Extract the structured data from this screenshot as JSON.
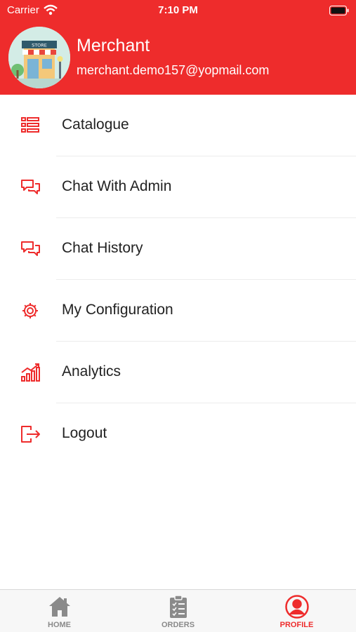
{
  "status_bar": {
    "carrier": "Carrier",
    "time": "7:10 PM"
  },
  "profile": {
    "name": "Merchant",
    "email": "merchant.demo157@yopmail.com",
    "avatar_sign": "STORE"
  },
  "menu": [
    {
      "label": "Catalogue",
      "icon": "list-icon"
    },
    {
      "label": "Chat With Admin",
      "icon": "chat-icon"
    },
    {
      "label": "Chat History",
      "icon": "chat-icon"
    },
    {
      "label": "My Configuration",
      "icon": "gear-icon"
    },
    {
      "label": "Analytics",
      "icon": "chart-icon"
    },
    {
      "label": "Logout",
      "icon": "logout-icon"
    }
  ],
  "tabs": [
    {
      "label": "HOME",
      "icon": "home-icon"
    },
    {
      "label": "ORDERS",
      "icon": "clipboard-icon"
    },
    {
      "label": "PROFILE",
      "icon": "profile-icon",
      "active": true
    }
  ],
  "colors": {
    "accent": "#ee2c2c",
    "inactive_tab": "#8a8a8a"
  }
}
